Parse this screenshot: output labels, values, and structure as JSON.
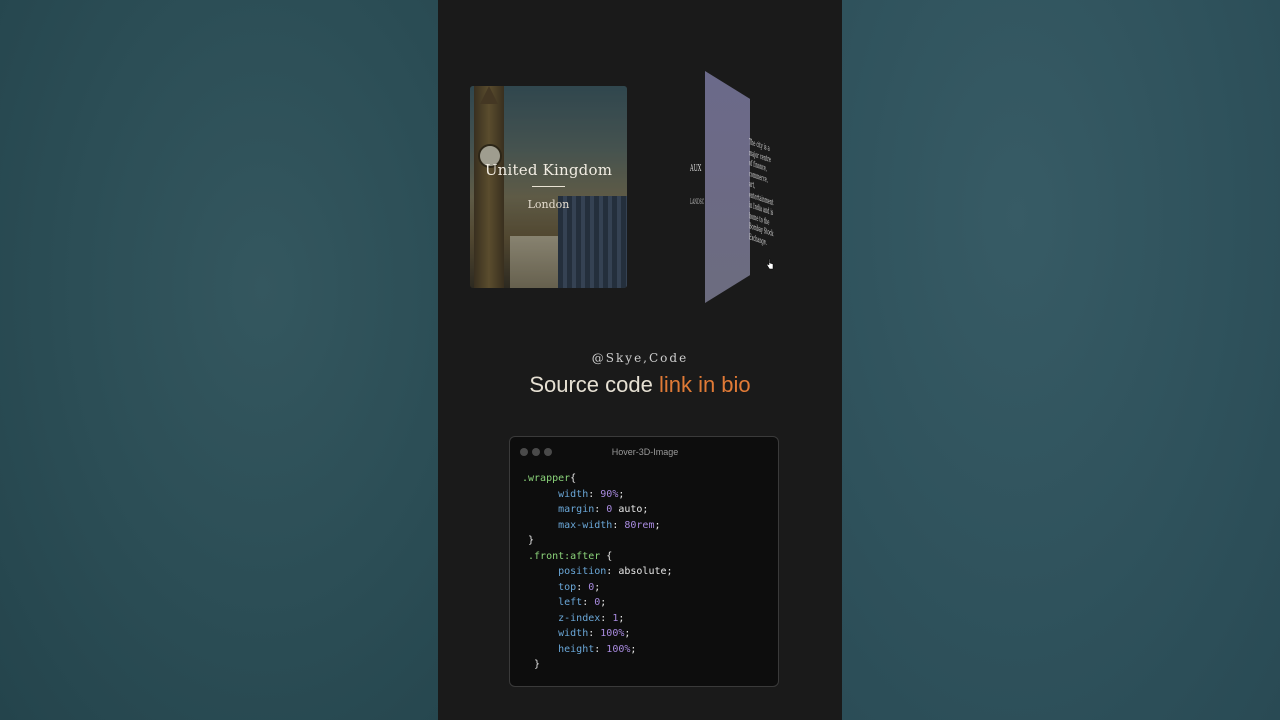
{
  "front_card": {
    "title": "United Kingdom",
    "subtitle": "London"
  },
  "back_card": {
    "letters_main": "AUX",
    "letters_sub": "LANDSC",
    "paragraph": "The city is a major centre of finance, commerce, art, entertainment in India and is home to the Bombay Stock Exchange."
  },
  "handle": "@Skye,Code",
  "headline": {
    "lead": "Source code ",
    "accent": "link in bio"
  },
  "code_window": {
    "title": "Hover-3D-Image",
    "lines": [
      [
        {
          "t": ".wrapper",
          "c": "sel"
        },
        {
          "t": "{",
          "c": "plain"
        }
      ],
      [
        {
          "t": "      width",
          "c": "prop"
        },
        {
          "t": ": ",
          "c": "plain"
        },
        {
          "t": "90%",
          "c": "num"
        },
        {
          "t": ";",
          "c": "plain"
        }
      ],
      [
        {
          "t": "      margin",
          "c": "prop"
        },
        {
          "t": ": ",
          "c": "plain"
        },
        {
          "t": "0",
          "c": "num"
        },
        {
          "t": " auto;",
          "c": "plain"
        }
      ],
      [
        {
          "t": "      max-width",
          "c": "prop"
        },
        {
          "t": ": ",
          "c": "plain"
        },
        {
          "t": "80rem",
          "c": "num"
        },
        {
          "t": ";",
          "c": "plain"
        }
      ],
      [
        {
          "t": " }",
          "c": "plain"
        }
      ],
      [
        {
          "t": " .front:after",
          "c": "sel"
        },
        {
          "t": " {",
          "c": "plain"
        }
      ],
      [
        {
          "t": "      position",
          "c": "prop"
        },
        {
          "t": ": absolute;",
          "c": "plain"
        }
      ],
      [
        {
          "t": "      top",
          "c": "prop"
        },
        {
          "t": ": ",
          "c": "plain"
        },
        {
          "t": "0",
          "c": "num"
        },
        {
          "t": ";",
          "c": "plain"
        }
      ],
      [
        {
          "t": "      left",
          "c": "prop"
        },
        {
          "t": ": ",
          "c": "plain"
        },
        {
          "t": "0",
          "c": "num"
        },
        {
          "t": ";",
          "c": "plain"
        }
      ],
      [
        {
          "t": "      z-index",
          "c": "prop"
        },
        {
          "t": ": ",
          "c": "plain"
        },
        {
          "t": "1",
          "c": "num"
        },
        {
          "t": ";",
          "c": "plain"
        }
      ],
      [
        {
          "t": "      width",
          "c": "prop"
        },
        {
          "t": ": ",
          "c": "plain"
        },
        {
          "t": "100%",
          "c": "num"
        },
        {
          "t": ";",
          "c": "plain"
        }
      ],
      [
        {
          "t": "      height",
          "c": "prop"
        },
        {
          "t": ": ",
          "c": "plain"
        },
        {
          "t": "100%",
          "c": "num"
        },
        {
          "t": ";",
          "c": "plain"
        }
      ],
      [
        {
          "t": "  }",
          "c": "plain"
        }
      ]
    ]
  }
}
